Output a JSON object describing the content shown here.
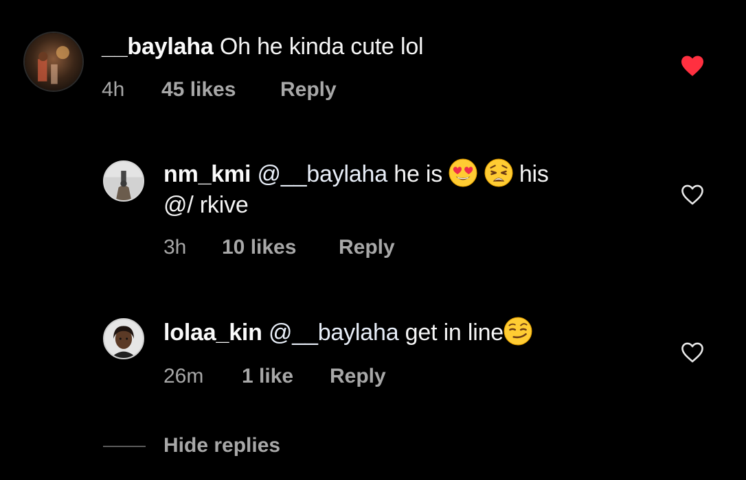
{
  "comments": [
    {
      "username": "__baylaha",
      "text": "Oh he kinda cute lol",
      "time": "4h",
      "likes": "45 likes",
      "reply": "Reply",
      "liked": true,
      "avatar_icon": "profile-photo"
    },
    {
      "username": "nm_kmi",
      "mention": "@__baylaha",
      "text_before_emoji": "he is",
      "emojis": [
        "smiling-face-with-heart-eyes",
        "weary-face"
      ],
      "text_after_emoji": "his",
      "text_line2": "@/ rkive",
      "time": "3h",
      "likes": "10 likes",
      "reply": "Reply",
      "liked": false,
      "avatar_icon": "profile-photo"
    },
    {
      "username": "lolaa_kin",
      "mention": "@__baylaha",
      "text": "get in line",
      "emojis": [
        "smirking-face"
      ],
      "time": "26m",
      "likes": "1 like",
      "reply": "Reply",
      "liked": false,
      "avatar_icon": "profile-photo"
    }
  ],
  "hide_replies": "Hide replies",
  "colors": {
    "background": "#000000",
    "heart_liked": "#ff3040",
    "meta_text": "#a8a8a8",
    "username": "#fafafa"
  }
}
